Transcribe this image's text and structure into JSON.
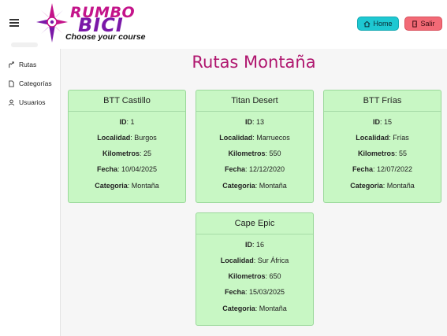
{
  "header": {
    "logo_line1": "RUMBO",
    "logo_line2": "BICI",
    "logo_tagline": "Choose your course",
    "home_label": "Home",
    "exit_label": "Salir"
  },
  "sidebar": {
    "items": [
      {
        "label": "Rutas",
        "icon": "route-icon"
      },
      {
        "label": "Categorías",
        "icon": "document-icon"
      },
      {
        "label": "Usuarios",
        "icon": "user-icon"
      }
    ]
  },
  "main": {
    "title": "Rutas Montaña",
    "labels": {
      "id": "ID",
      "localidad": "Localidad",
      "kilometros": "Kilometros",
      "fecha": "Fecha",
      "categoria": "Categoria"
    },
    "routes": [
      {
        "name": "BTT Castillo",
        "id": "1",
        "localidad": "Burgos",
        "kilometros": "25",
        "fecha": "10/04/2025",
        "categoria": "Montaña"
      },
      {
        "name": "Titan Desert",
        "id": "13",
        "localidad": "Marruecos",
        "kilometros": "550",
        "fecha": "12/12/2020",
        "categoria": "Montaña"
      },
      {
        "name": "BTT Frías",
        "id": "15",
        "localidad": "Frías",
        "kilometros": "55",
        "fecha": "12/07/2022",
        "categoria": "Montaña"
      },
      {
        "name": "Cape Epic",
        "id": "16",
        "localidad": "Sur África",
        "kilometros": "650",
        "fecha": "15/03/2025",
        "categoria": "Montaña"
      }
    ]
  },
  "colors": {
    "title": "#b0176f",
    "card_bg": "#c8f7c4",
    "home_button": "#1ec8d2",
    "exit_button": "#f26a76",
    "logo_pink": "#c4148a",
    "logo_purple": "#7a18a8"
  }
}
